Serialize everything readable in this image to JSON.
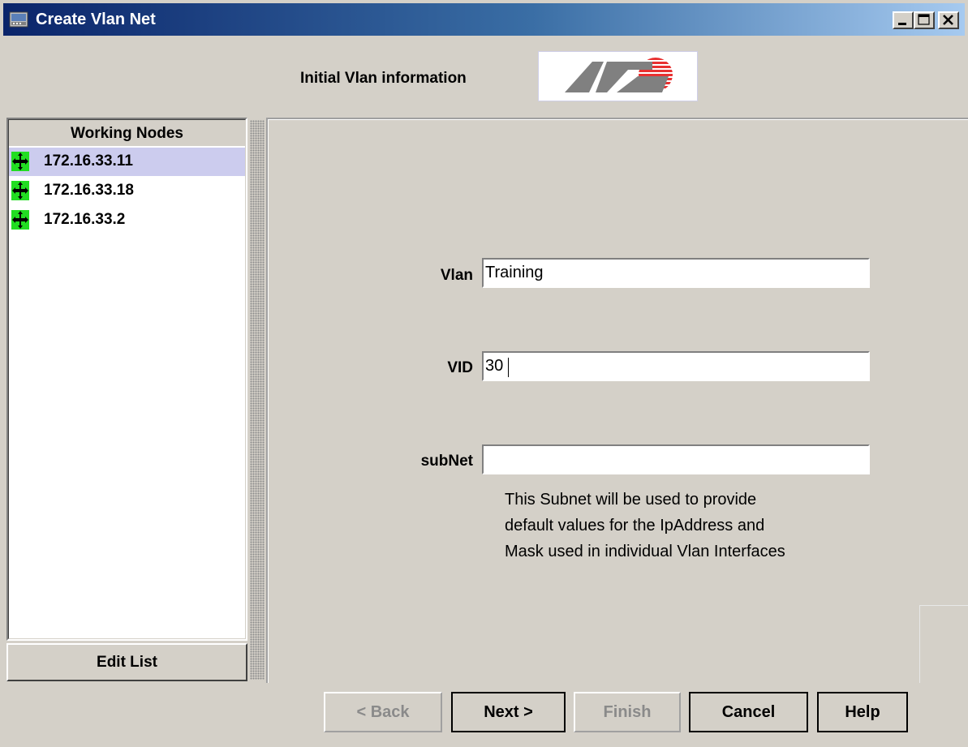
{
  "window": {
    "title": "Create Vlan Net",
    "controls": [
      "minimize-icon",
      "maximize-icon",
      "close-icon"
    ]
  },
  "header": {
    "title": "Initial Vlan information",
    "logo": "allied-telesyn-logo",
    "logo_colors": [
      "#808080",
      "#e83030"
    ]
  },
  "sidebar": {
    "header": "Working Nodes",
    "node_icon": "switch-node-icon",
    "items": [
      {
        "label": "172.16.33.11",
        "selected": true
      },
      {
        "label": "172.16.33.18",
        "selected": false
      },
      {
        "label": "172.16.33.2",
        "selected": false
      }
    ],
    "edit_button": "Edit List"
  },
  "form": {
    "vlan": {
      "label": "Vlan",
      "value": "Training"
    },
    "vid": {
      "label": "VID",
      "value": "30"
    },
    "subnet": {
      "label": "subNet",
      "value": ""
    },
    "help_lines": [
      "This Subnet will be used to provide",
      "default values for the IpAddress and",
      "Mask used in individual Vlan Interfaces"
    ]
  },
  "buttons": {
    "back": "< Back",
    "next": "Next >",
    "finish": "Finish",
    "cancel": "Cancel",
    "help": "Help"
  },
  "colors": {
    "titlebar_start": "#0a246a",
    "titlebar_end": "#a6caf0",
    "selected_row": "#ccccee",
    "node_icon_green": "#22dd22"
  }
}
